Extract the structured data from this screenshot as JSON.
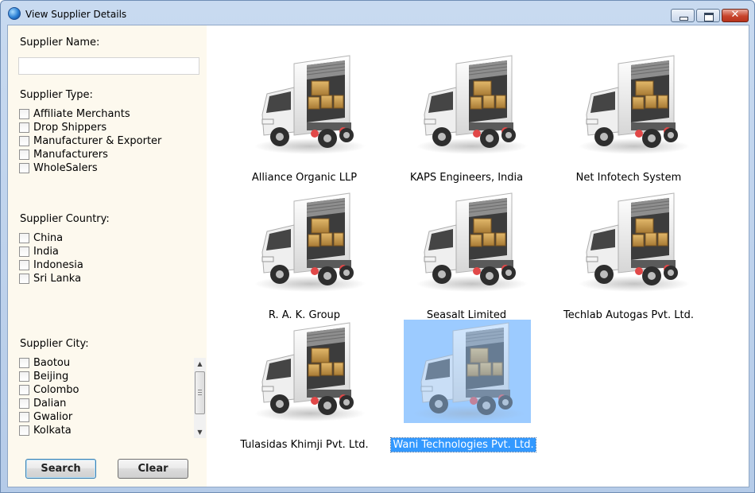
{
  "window": {
    "title": "View Supplier Details",
    "close_glyph": "✕"
  },
  "filters": {
    "name_label": "Supplier Name:",
    "name_value": "",
    "type_label": "Supplier Type:",
    "types": [
      {
        "label": "Affiliate Merchants",
        "checked": false
      },
      {
        "label": "Drop Shippers",
        "checked": false
      },
      {
        "label": "Manufacturer & Exporter",
        "checked": false
      },
      {
        "label": "Manufacturers",
        "checked": false
      },
      {
        "label": "WholeSalers",
        "checked": false
      }
    ],
    "country_label": "Supplier Country:",
    "countries": [
      {
        "label": "China",
        "checked": false
      },
      {
        "label": "India",
        "checked": false
      },
      {
        "label": "Indonesia",
        "checked": false
      },
      {
        "label": "Sri Lanka",
        "checked": false
      }
    ],
    "city_label": "Supplier City:",
    "cities": [
      {
        "label": "Baotou",
        "checked": false
      },
      {
        "label": "Beijing",
        "checked": false
      },
      {
        "label": "Colombo",
        "checked": false
      },
      {
        "label": "Dalian",
        "checked": false
      },
      {
        "label": "Gwalior",
        "checked": false
      },
      {
        "label": "Kolkata",
        "checked": false
      }
    ],
    "city_scroll_up": "▲",
    "city_scroll_down": "▼",
    "search_label": "Search",
    "clear_label": "Clear"
  },
  "suppliers": [
    {
      "name": "Alliance Organic LLP",
      "icon": "delivery-truck-icon",
      "selected": false
    },
    {
      "name": "KAPS Engineers, India",
      "icon": "delivery-truck-icon",
      "selected": false
    },
    {
      "name": "Net Infotech System",
      "icon": "delivery-truck-icon",
      "selected": false
    },
    {
      "name": "R. A. K. Group",
      "icon": "delivery-truck-icon",
      "selected": false
    },
    {
      "name": "Seasalt Limited",
      "icon": "delivery-truck-icon",
      "selected": false
    },
    {
      "name": "Techlab Autogas Pvt. Ltd.",
      "icon": "delivery-truck-icon",
      "selected": false
    },
    {
      "name": "Tulasidas Khimji Pvt. Ltd.",
      "icon": "delivery-truck-icon",
      "selected": false
    },
    {
      "name": "Wani Technologies Pvt. Ltd.",
      "icon": "delivery-truck-icon",
      "selected": true
    }
  ],
  "colors": {
    "panel_bg": "#fdf9ee",
    "selection": "#3399ff",
    "selection_thumb": "#9ccbff"
  }
}
